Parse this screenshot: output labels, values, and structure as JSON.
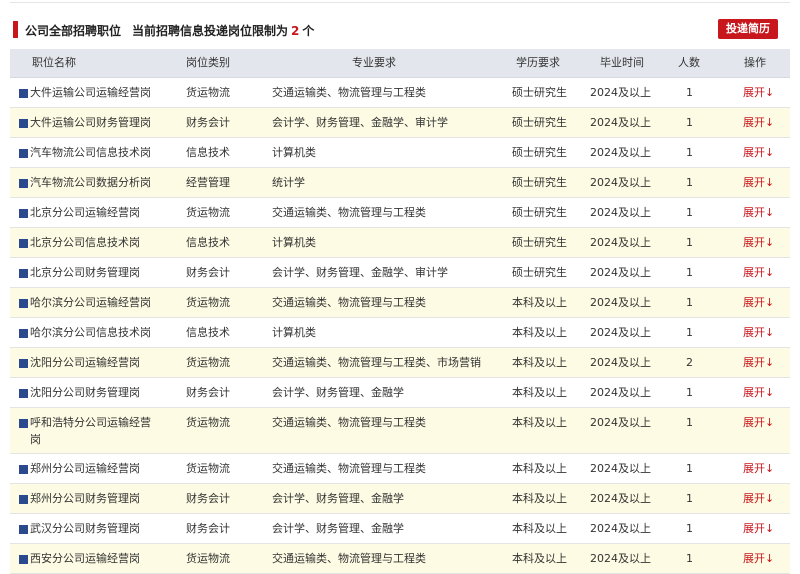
{
  "header": {
    "title": "公司全部招聘职位",
    "note_prefix": "当前招聘信息投递岗位限制为",
    "limit": "2",
    "note_suffix": "个",
    "submit_label": "投递简历"
  },
  "columns": {
    "name": "职位名称",
    "type": "岗位类别",
    "major": "专业要求",
    "edu": "学历要求",
    "grad": "毕业时间",
    "num": "人数",
    "op": "操作"
  },
  "jobs": [
    {
      "name": "大件运输公司运输经营岗",
      "type": "货运物流",
      "major": "交通运输类、物流管理与工程类",
      "edu": "硕士研究生",
      "grad": "2024及以上",
      "num": "1",
      "op": "展开↓"
    },
    {
      "name": "大件运输公司财务管理岗",
      "type": "财务会计",
      "major": "会计学、财务管理、金融学、审计学",
      "edu": "硕士研究生",
      "grad": "2024及以上",
      "num": "1",
      "op": "展开↓"
    },
    {
      "name": "汽车物流公司信息技术岗",
      "type": "信息技术",
      "major": "计算机类",
      "edu": "硕士研究生",
      "grad": "2024及以上",
      "num": "1",
      "op": "展开↓"
    },
    {
      "name": "汽车物流公司数据分析岗",
      "type": "经营管理",
      "major": "统计学",
      "edu": "硕士研究生",
      "grad": "2024及以上",
      "num": "1",
      "op": "展开↓"
    },
    {
      "name": "北京分公司运输经营岗",
      "type": "货运物流",
      "major": "交通运输类、物流管理与工程类",
      "edu": "硕士研究生",
      "grad": "2024及以上",
      "num": "1",
      "op": "展开↓"
    },
    {
      "name": "北京分公司信息技术岗",
      "type": "信息技术",
      "major": "计算机类",
      "edu": "硕士研究生",
      "grad": "2024及以上",
      "num": "1",
      "op": "展开↓"
    },
    {
      "name": "北京分公司财务管理岗",
      "type": "财务会计",
      "major": "会计学、财务管理、金融学、审计学",
      "edu": "硕士研究生",
      "grad": "2024及以上",
      "num": "1",
      "op": "展开↓"
    },
    {
      "name": "哈尔滨分公司运输经营岗",
      "type": "货运物流",
      "major": "交通运输类、物流管理与工程类",
      "edu": "本科及以上",
      "grad": "2024及以上",
      "num": "1",
      "op": "展开↓"
    },
    {
      "name": "哈尔滨分公司信息技术岗",
      "type": "信息技术",
      "major": "计算机类",
      "edu": "本科及以上",
      "grad": "2024及以上",
      "num": "1",
      "op": "展开↓"
    },
    {
      "name": "沈阳分公司运输经营岗",
      "type": "货运物流",
      "major": "交通运输类、物流管理与工程类、市场营销",
      "edu": "本科及以上",
      "grad": "2024及以上",
      "num": "2",
      "op": "展开↓"
    },
    {
      "name": "沈阳分公司财务管理岗",
      "type": "财务会计",
      "major": "会计学、财务管理、金融学",
      "edu": "本科及以上",
      "grad": "2024及以上",
      "num": "1",
      "op": "展开↓"
    },
    {
      "name": "呼和浩特分公司运输经营岗",
      "type": "货运物流",
      "major": "交通运输类、物流管理与工程类",
      "edu": "本科及以上",
      "grad": "2024及以上",
      "num": "1",
      "op": "展开↓"
    },
    {
      "name": "郑州分公司运输经营岗",
      "type": "货运物流",
      "major": "交通运输类、物流管理与工程类",
      "edu": "本科及以上",
      "grad": "2024及以上",
      "num": "1",
      "op": "展开↓"
    },
    {
      "name": "郑州分公司财务管理岗",
      "type": "财务会计",
      "major": "会计学、财务管理、金融学",
      "edu": "本科及以上",
      "grad": "2024及以上",
      "num": "1",
      "op": "展开↓"
    },
    {
      "name": "武汉分公司财务管理岗",
      "type": "财务会计",
      "major": "会计学、财务管理、金融学",
      "edu": "本科及以上",
      "grad": "2024及以上",
      "num": "1",
      "op": "展开↓"
    },
    {
      "name": "西安分公司运输经营岗",
      "type": "货运物流",
      "major": "交通运输类、物流管理与工程类",
      "edu": "本科及以上",
      "grad": "2024及以上",
      "num": "1",
      "op": "展开↓"
    }
  ],
  "colors": {
    "accent": "#c8161d",
    "header_bg": "#e3e6ec",
    "stripe": "#fdfbe3",
    "marker": "#2a4a8d"
  }
}
